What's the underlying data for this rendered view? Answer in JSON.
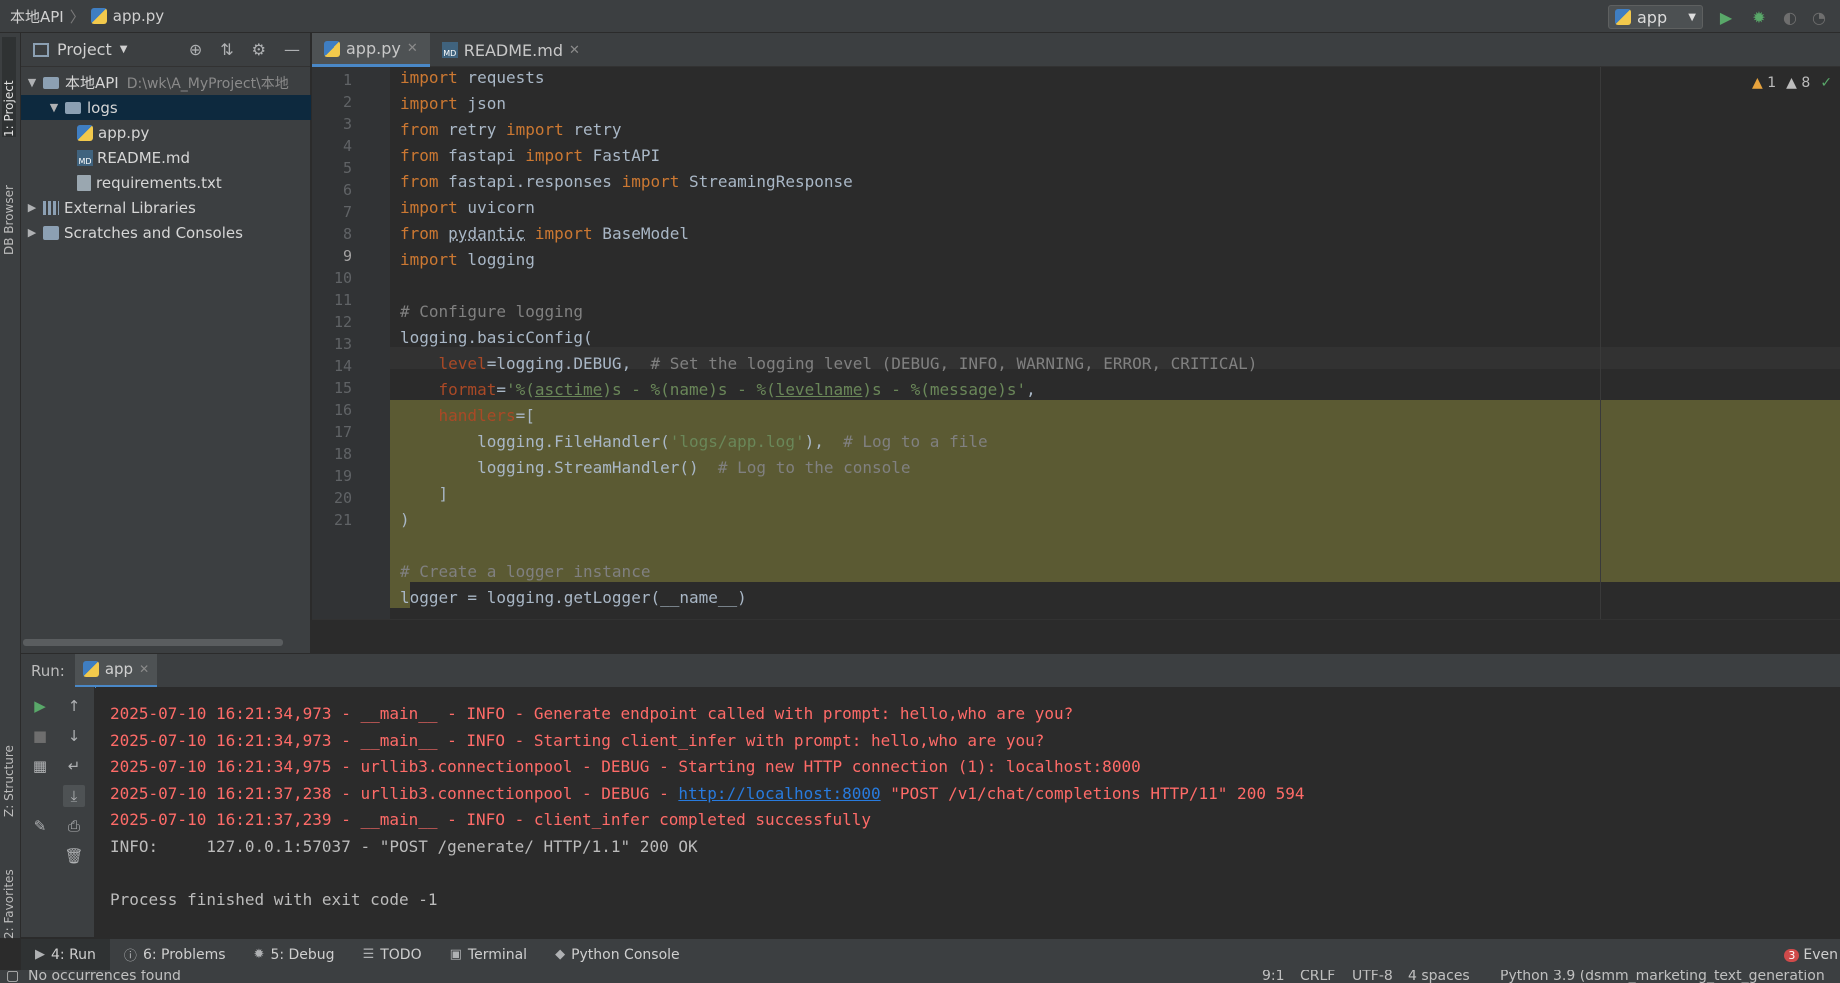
{
  "breadcrumb": {
    "project": "本地API",
    "file": "app.py"
  },
  "toolbar": {
    "run_config": "app",
    "run_icon": "play-icon",
    "debug_icon": "bug-icon",
    "coverage_icon": "coverage-icon"
  },
  "left_strip": {
    "project_tab": "1: Project",
    "db_tab": "DB Browser",
    "structure_tab": "Z: Structure",
    "favorites_tab": "2: Favorites"
  },
  "project": {
    "title": "Project",
    "tree": [
      {
        "label": "本地API",
        "path": "D:\\wk\\A_MyProject\\本地"
      },
      {
        "label": "logs"
      },
      {
        "label": "app.py"
      },
      {
        "label": "README.md"
      },
      {
        "label": "requirements.txt"
      },
      {
        "label": "External Libraries"
      },
      {
        "label": "Scratches and Consoles"
      }
    ]
  },
  "editor": {
    "tabs": [
      {
        "label": "app.py"
      },
      {
        "label": "README.md"
      }
    ],
    "inspections": {
      "warnings": "1",
      "weak_warnings": "8"
    },
    "line_numbers": [
      "1",
      "2",
      "3",
      "4",
      "5",
      "6",
      "7",
      "8",
      "9",
      "10",
      "11",
      "12",
      "13",
      "14",
      "15",
      "16",
      "17",
      "18",
      "19",
      "20",
      "21"
    ]
  },
  "run": {
    "label": "Run:",
    "tab": "app",
    "console": [
      {
        "text": "2025-07-10 16:21:34,973 - __main__ - INFO - Generate endpoint called with prompt: hello,who are you?"
      },
      {
        "text": "2025-07-10 16:21:34,973 - __main__ - INFO - Starting client_infer with prompt: hello,who are you?"
      },
      {
        "text": "2025-07-10 16:21:34,975 - urllib3.connectionpool - DEBUG - Starting new HTTP connection (1): localhost:8000"
      },
      {
        "prefix": "2025-07-10 16:21:37,238 - urllib3.connectionpool - DEBUG - ",
        "link": "http://localhost:8000",
        "suffix": " \"POST /v1/chat/completions HTTP/11\" 200 594"
      },
      {
        "text": "2025-07-10 16:21:37,239 - __main__ - INFO - client_infer completed successfully"
      },
      {
        "text": "INFO:     127.0.0.1:57037 - \"POST /generate/ HTTP/1.1\" 200 OK"
      },
      {
        "text": ""
      },
      {
        "text": "Process finished with exit code -1"
      }
    ]
  },
  "bottom_tabs": {
    "run": "4: Run",
    "problems": "6: Problems",
    "debug": "5: Debug",
    "todo": "TODO",
    "terminal": "Terminal",
    "python_console": "Python Console",
    "events_count": "3",
    "events": "Even"
  },
  "status": {
    "message": "No occurrences found",
    "position": "9:1",
    "line_sep": "CRLF",
    "encoding": "UTF-8",
    "indent": "4 spaces",
    "interpreter": "Python 3.9 (dsmm_marketing_text_generation"
  },
  "colors": {
    "keyword": "#cc7832",
    "comment": "#808080",
    "string": "#6a8759",
    "error_text": "#ff6b68",
    "link": "#287bde",
    "selection": "#5b5a33"
  }
}
